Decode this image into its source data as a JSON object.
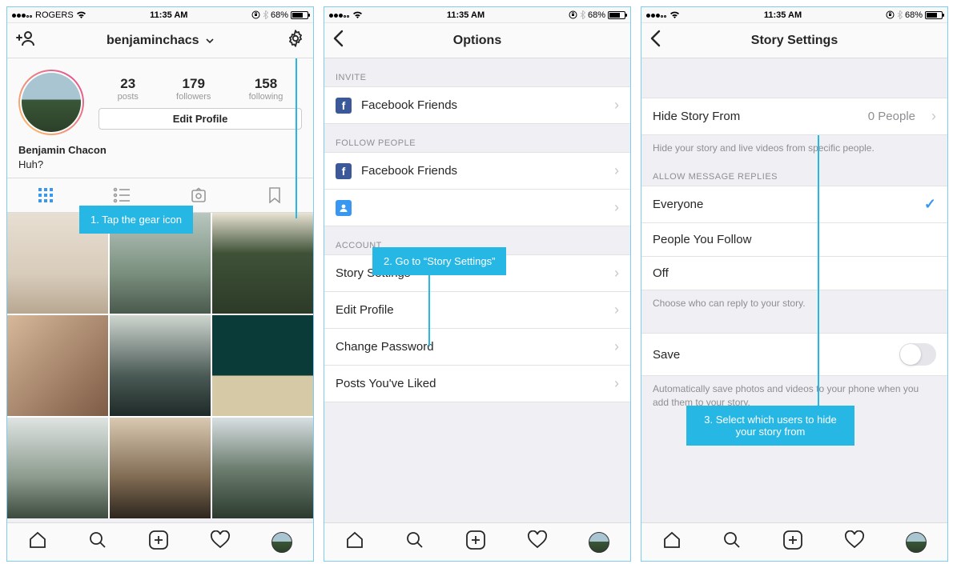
{
  "status": {
    "carrier": "ROGERS",
    "time": "11:35 AM",
    "battery_pct": "68%"
  },
  "pane1": {
    "nav": {
      "username": "benjaminchacs"
    },
    "stats": {
      "posts": {
        "count": "23",
        "label": "posts"
      },
      "followers": {
        "count": "179",
        "label": "followers"
      },
      "following": {
        "count": "158",
        "label": "following"
      }
    },
    "edit_profile": "Edit Profile",
    "name": "Benjamin Chacon",
    "bio_line": "Huh?",
    "callout": "1. Tap the gear icon"
  },
  "pane2": {
    "title": "Options",
    "sections": {
      "invite": {
        "header": "INVITE"
      },
      "follow": {
        "header": "FOLLOW PEOPLE"
      },
      "account": {
        "header": "ACCOUNT"
      }
    },
    "rows": {
      "fb_friends": "Facebook Friends",
      "story_settings": "Story Settings",
      "edit_profile": "Edit Profile",
      "change_password": "Change Password",
      "posts_liked": "Posts You've Liked"
    },
    "callout": "2. Go to “Story Settings”"
  },
  "pane3": {
    "title": "Story Settings",
    "hide_from": {
      "label": "Hide Story From",
      "value": "0 People"
    },
    "hide_note": "Hide your story and live videos from specific people.",
    "allow_header": "ALLOW MESSAGE REPLIES",
    "replies": {
      "everyone": "Everyone",
      "follow": "People You Follow",
      "off": "Off"
    },
    "allow_note": "Choose who can reply to your story.",
    "save_row": "Save",
    "save_note": "Automatically save photos and videos to your phone when you add them to your story.",
    "callout": "3. Select which users to hide your story from"
  }
}
